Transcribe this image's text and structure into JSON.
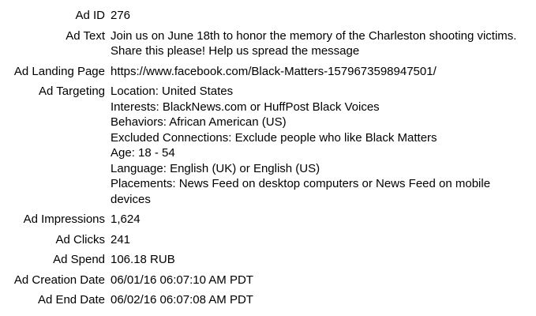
{
  "fields": {
    "ad_id": {
      "label": "Ad ID",
      "value": "276"
    },
    "ad_text": {
      "label": "Ad Text",
      "value": "Join us on June 18th to honor the memory of the Charleston shooting victims. Share this please! Help us spread the message"
    },
    "ad_landing_page": {
      "label": "Ad Landing Page",
      "value": "https://www.facebook.com/Black-Matters-1579673598947501/"
    },
    "ad_targeting": {
      "label": "Ad Targeting",
      "lines": [
        "Location: United States",
        "Interests: BlackNews.com or HuffPost Black Voices",
        "Behaviors: African American (US)",
        "Excluded Connections: Exclude people who like Black Matters",
        "Age: 18 - 54",
        "Language: English (UK) or English (US)",
        "Placements: News Feed on desktop computers or News Feed on mobile devices"
      ]
    },
    "ad_impressions": {
      "label": "Ad Impressions",
      "value": "1,624"
    },
    "ad_clicks": {
      "label": "Ad Clicks",
      "value": "241"
    },
    "ad_spend": {
      "label": "Ad Spend",
      "value": "106.18 RUB"
    },
    "ad_creation_date": {
      "label": "Ad Creation Date",
      "value": "06/01/16 06:07:10 AM PDT"
    },
    "ad_end_date": {
      "label": "Ad End Date",
      "value": "06/02/16 06:07:08 AM PDT"
    }
  }
}
